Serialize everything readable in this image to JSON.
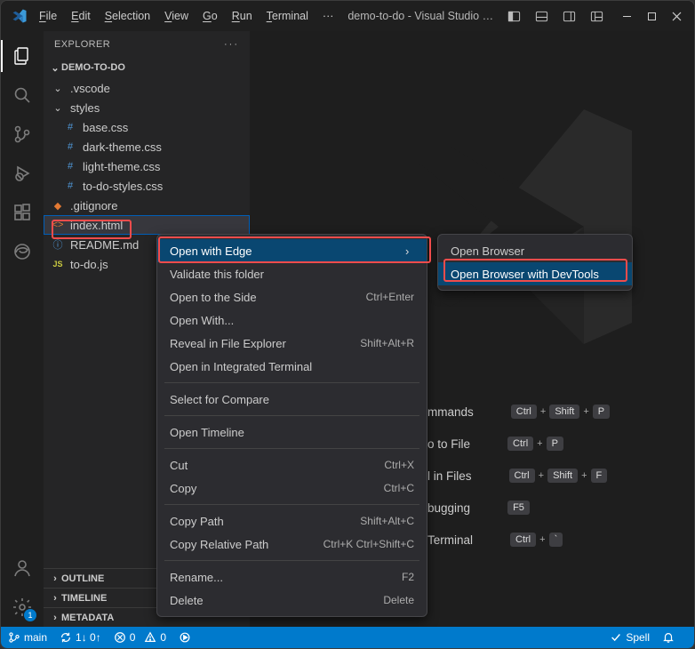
{
  "menubar": {
    "file": "File",
    "edit": "Edit",
    "selection": "Selection",
    "view": "View",
    "go": "Go",
    "run": "Run",
    "terminal": "Terminal",
    "more": "···"
  },
  "title": "demo-to-do - Visual Studio …",
  "explorer": {
    "title": "EXPLORER",
    "project": "DEMO-TO-DO"
  },
  "tree": {
    "vscode": ".vscode",
    "styles": "styles",
    "base": "base.css",
    "dark": "dark-theme.css",
    "light": "light-theme.css",
    "todostyles": "to-do-styles.css",
    "gitignore": ".gitignore",
    "index": "index.html",
    "readme": "README.md",
    "todojs": "to-do.js"
  },
  "sections": {
    "outline": "OUTLINE",
    "timeline": "TIMELINE",
    "metadata": "METADATA"
  },
  "context": {
    "openEdge": "Open with Edge",
    "validate": "Validate this folder",
    "openSide": "Open to the Side",
    "openSideKey": "Ctrl+Enter",
    "openWith": "Open With...",
    "reveal": "Reveal in File Explorer",
    "revealKey": "Shift+Alt+R",
    "openTerm": "Open in Integrated Terminal",
    "selCompare": "Select for Compare",
    "timeline": "Open Timeline",
    "cut": "Cut",
    "cutKey": "Ctrl+X",
    "copy": "Copy",
    "copyKey": "Ctrl+C",
    "copyPath": "Copy Path",
    "copyPathKey": "Shift+Alt+C",
    "copyRel": "Copy Relative Path",
    "copyRelKey": "Ctrl+K Ctrl+Shift+C",
    "rename": "Rename...",
    "renameKey": "F2",
    "delete": "Delete",
    "deleteKey": "Delete"
  },
  "submenu": {
    "openBrowser": "Open Browser",
    "openDevtools": "Open Browser with DevTools"
  },
  "welcome": {
    "commands": "mmands",
    "goto": "o to File",
    "find": "l in Files",
    "debug": "bugging",
    "terminal": "Terminal",
    "ctrl": "Ctrl",
    "shift": "Shift",
    "p": "P",
    "f": "F",
    "f5": "F5",
    "tick": "`"
  },
  "status": {
    "branch": "main",
    "sync": "1↓ 0↑",
    "err": "0",
    "warn": "0",
    "spell": "Spell",
    "badge": "1"
  }
}
